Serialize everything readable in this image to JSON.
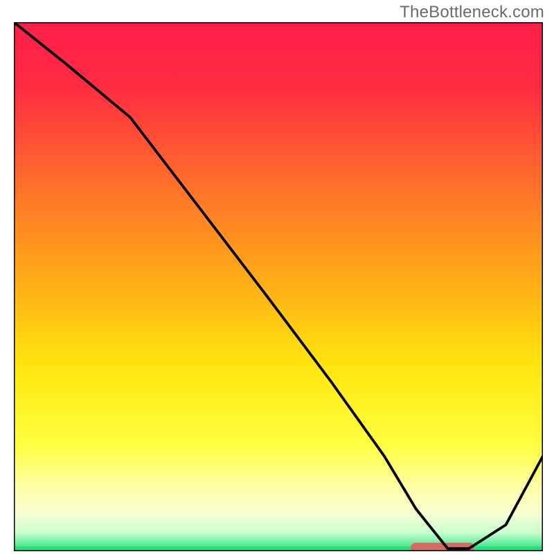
{
  "watermark": "TheBottleneck.com",
  "chart_data": {
    "type": "line",
    "title": "",
    "xlabel": "",
    "ylabel": "",
    "xlim": [
      0,
      100
    ],
    "ylim": [
      0,
      100
    ],
    "gradient_stops": [
      {
        "offset": 0,
        "color": "#ff1f4b"
      },
      {
        "offset": 0.12,
        "color": "#ff2b41"
      },
      {
        "offset": 0.3,
        "color": "#ff6d2b"
      },
      {
        "offset": 0.5,
        "color": "#ffb016"
      },
      {
        "offset": 0.65,
        "color": "#ffe60e"
      },
      {
        "offset": 0.8,
        "color": "#ffff41"
      },
      {
        "offset": 0.88,
        "color": "#ffffa8"
      },
      {
        "offset": 0.93,
        "color": "#f6ffd2"
      },
      {
        "offset": 0.965,
        "color": "#c9ffd0"
      },
      {
        "offset": 1.0,
        "color": "#24e07c"
      }
    ],
    "series": [
      {
        "name": "bottleneck-curve",
        "x": [
          0,
          10,
          22,
          35,
          48,
          60,
          70,
          76,
          82,
          86,
          93,
          100
        ],
        "y": [
          100,
          92,
          82,
          65,
          48,
          32,
          18,
          8,
          0.5,
          0.5,
          5,
          18
        ]
      }
    ],
    "marker": {
      "name": "target-range",
      "x_start": 76,
      "x_end": 86,
      "color": "#d46a62",
      "thickness": 2.0
    },
    "baseline": {
      "color": "#24e07c",
      "thickness": 1.2
    },
    "frame_color": "#000000",
    "line_color": "#000000",
    "line_width": 0.5
  }
}
